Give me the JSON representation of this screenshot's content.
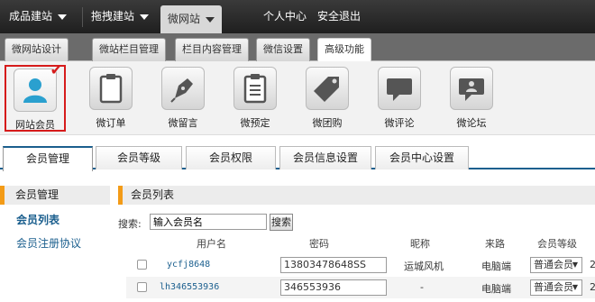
{
  "topnav": {
    "items": [
      {
        "label": "成品建站"
      },
      {
        "label": "拖拽建站"
      },
      {
        "label": "微网站"
      }
    ],
    "user_center": "个人中心",
    "logout": "安全退出"
  },
  "tabs": [
    {
      "label": "微网站设计"
    },
    {
      "label": "微站栏目管理"
    },
    {
      "label": "栏目内容管理"
    },
    {
      "label": "微信设置"
    },
    {
      "label": "高级功能"
    }
  ],
  "features": [
    {
      "label": "网站会员",
      "icon": "person-icon"
    },
    {
      "label": "微订单",
      "icon": "clipboard-icon"
    },
    {
      "label": "微留言",
      "icon": "pen-icon"
    },
    {
      "label": "微预定",
      "icon": "checklist-icon"
    },
    {
      "label": "微团购",
      "icon": "tag-icon"
    },
    {
      "label": "微评论",
      "icon": "chat-bubble-icon"
    },
    {
      "label": "微论坛",
      "icon": "forum-icon"
    }
  ],
  "member_tabs": [
    {
      "label": "会员管理"
    },
    {
      "label": "会员等级"
    },
    {
      "label": "会员权限"
    },
    {
      "label": "会员信息设置"
    },
    {
      "label": "会员中心设置"
    }
  ],
  "sidebar": {
    "title": "会员管理",
    "links": [
      {
        "label": "会员列表"
      },
      {
        "label": "会员注册协议"
      }
    ]
  },
  "panel": {
    "title": "会员列表",
    "search_label": "搜索:",
    "search_value": "输入会员名",
    "search_button": "搜索"
  },
  "table": {
    "headers": [
      "用户名",
      "密码",
      "昵称",
      "来路",
      "会员等级"
    ],
    "rows": [
      {
        "username": "ycfj8648",
        "password": "13803478648SS",
        "nickname": "运城风机",
        "source": "电脑端",
        "level": "普通会员",
        "trail": "2"
      },
      {
        "username": "lh346553936",
        "password": "346553936",
        "nickname": "-",
        "source": "电脑端",
        "level": "普通会员",
        "trail": "2"
      }
    ]
  },
  "colors": {
    "accent": "#f39b17",
    "link": "#1b5f8e",
    "selected_border": "#d61b1b"
  }
}
